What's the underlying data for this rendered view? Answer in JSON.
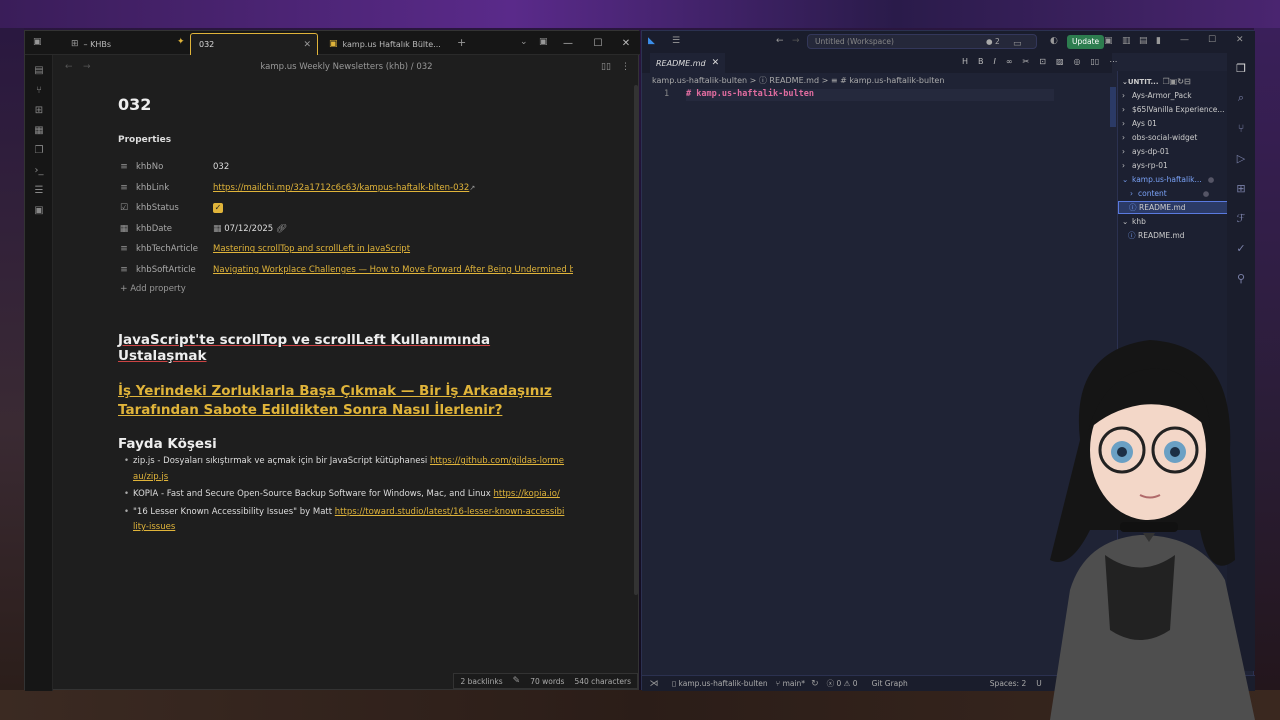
{
  "obsidian": {
    "tabs": [
      {
        "label": "– KHBs"
      },
      {
        "label": "032"
      },
      {
        "label": "kamp.us Haftalık Bülte..."
      }
    ],
    "header_path": "kamp.us Weekly Newsletters (khb)  /  032",
    "title": "032",
    "properties_label": "Properties",
    "properties": [
      {
        "key": "khbNo",
        "value": "032"
      },
      {
        "key": "khbLink",
        "value": "https://mailchi.mp/32a1712c6c63/kampus-haftalk-blten-032"
      },
      {
        "key": "khbStatus",
        "value": "✓"
      },
      {
        "key": "khbDate",
        "value": "07/12/2025"
      },
      {
        "key": "khbTechArticle",
        "value": "Mastering scrollTop and scrollLeft in JavaScript"
      },
      {
        "key": "khbSoftArticle",
        "value": "Navigating Workplace Challenges — How to Move Forward After Being Undermined by a"
      }
    ],
    "add_property": "Add property",
    "heading1": "JavaScript'te scrollTop ve scrollLeft Kullanımında Ustalaşmak",
    "heading2": "İş Yerindeki Zorluklarla Başa Çıkmak — Bir İş Arkadaşınız Tarafından Sabote Edildikten Sonra Nasıl İlerlenir?",
    "heading3": "Fayda Köşesi",
    "bullets": [
      {
        "text": "zip.js - Dosyaları sıkıştırmak ve açmak için bir JavaScript kütüphanesi ",
        "link": "https://github.com/gildas-lormeau/zip.js"
      },
      {
        "text": "KOPIA - Fast and Secure Open-Source Backup Software for Windows, Mac, and Linux ",
        "link": "https://kopia.io/"
      },
      {
        "text": "\"16 Lesser Known Accessibility Issues\" by Matt ",
        "link": "https://toward.studio/latest/16-lesser-known-accessibility-issues"
      }
    ],
    "status": {
      "backlinks": "2 backlinks",
      "words": "70 words",
      "chars": "540 characters"
    }
  },
  "vscode": {
    "search": "Untitled (Workspace)",
    "badge_count": "2",
    "update_label": "Update",
    "tab": "README.md",
    "breadcrumb": "kamp.us-haftalik-bulten  >  ⓘ README.md  >  ≡ # kamp.us-haftalik-bulten",
    "line_no": "1",
    "code": "# kamp.us-haftalik-bulten",
    "explorer_title": "UNTIT...",
    "tree": [
      {
        "label": "Ays-Armor_Pack"
      },
      {
        "label": "$65lVanilla Experience..."
      },
      {
        "label": "Ays 01"
      },
      {
        "label": "obs-social-widget"
      },
      {
        "label": "ays-dp-01"
      },
      {
        "label": "ays-rp-01"
      },
      {
        "label": "kamp.us-haftalik..."
      },
      {
        "label": "content"
      },
      {
        "label": "README.md"
      },
      {
        "label": "khb"
      },
      {
        "label": "README.md"
      }
    ],
    "status": {
      "folder": "kamp.us-haftalik-bulten",
      "branch": "main*",
      "errors": "0",
      "warnings": "0",
      "git": "Git Graph",
      "spaces": "Spaces: 2",
      "enc": "U"
    }
  },
  "colors": {
    "accent": "#e0b43a",
    "vs_bg": "#1f2335",
    "obs_bg": "#1e1e1e"
  }
}
